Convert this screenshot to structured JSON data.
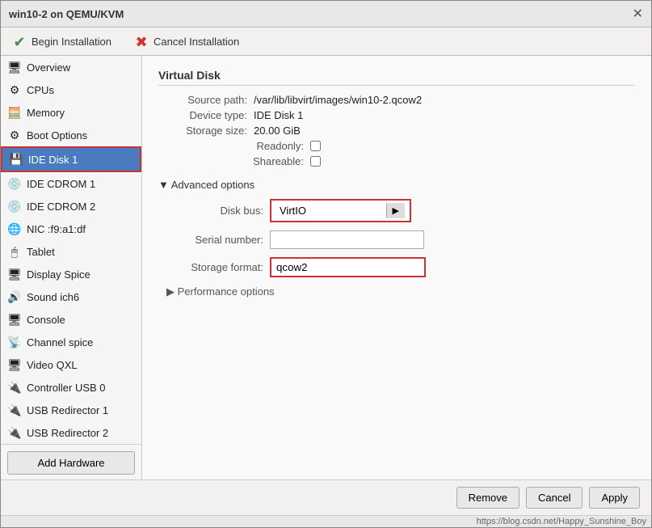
{
  "window": {
    "title": "win10-2 on QEMU/KVM",
    "close_label": "✕"
  },
  "toolbar": {
    "begin_label": "Begin Installation",
    "cancel_label": "Cancel Installation"
  },
  "sidebar": {
    "items": [
      {
        "id": "overview",
        "label": "Overview",
        "icon": "🖥"
      },
      {
        "id": "cpus",
        "label": "CPUs",
        "icon": "⚙"
      },
      {
        "id": "memory",
        "label": "Memory",
        "icon": "🧮"
      },
      {
        "id": "boot-options",
        "label": "Boot Options",
        "icon": "⚙"
      },
      {
        "id": "ide-disk-1",
        "label": "IDE Disk 1",
        "icon": "💾",
        "active": true
      },
      {
        "id": "ide-cdrom-1",
        "label": "IDE CDROM 1",
        "icon": "💿"
      },
      {
        "id": "ide-cdrom-2",
        "label": "IDE CDROM 2",
        "icon": "💿"
      },
      {
        "id": "nic",
        "label": "NIC :f9:a1:df",
        "icon": "🌐"
      },
      {
        "id": "tablet",
        "label": "Tablet",
        "icon": "🖱"
      },
      {
        "id": "display-spice",
        "label": "Display Spice",
        "icon": "🖥"
      },
      {
        "id": "sound-ich6",
        "label": "Sound ich6",
        "icon": "🔊"
      },
      {
        "id": "console",
        "label": "Console",
        "icon": "🖥"
      },
      {
        "id": "channel-spice",
        "label": "Channel spice",
        "icon": "📡"
      },
      {
        "id": "video-qxl",
        "label": "Video QXL",
        "icon": "🖥"
      },
      {
        "id": "controller-usb-0",
        "label": "Controller USB 0",
        "icon": "🔌"
      },
      {
        "id": "usb-redirector-1",
        "label": "USB Redirector 1",
        "icon": "🔌"
      },
      {
        "id": "usb-redirector-2",
        "label": "USB Redirector 2",
        "icon": "🔌"
      }
    ],
    "add_hardware_label": "Add Hardware"
  },
  "main": {
    "section_title": "Virtual Disk",
    "source_path_label": "Source path:",
    "source_path_value": "/var/lib/libvirt/images/win10-2.qcow2",
    "device_type_label": "Device type:",
    "device_type_value": "IDE Disk 1",
    "storage_size_label": "Storage size:",
    "storage_size_value": "20.00 GiB",
    "readonly_label": "Readonly:",
    "shareable_label": "Shareable:",
    "advanced_title": "▼ Advanced options",
    "diskbus_label": "Disk bus:",
    "diskbus_value": "VirtIO",
    "diskbus_arrow": "▶",
    "serial_label": "Serial number:",
    "serial_value": "",
    "storage_format_label": "Storage format:",
    "storage_format_value": "qcow2",
    "performance_label": "▶ Performance options"
  },
  "footer": {
    "remove_label": "Remove",
    "cancel_label": "Cancel",
    "apply_label": "Apply"
  },
  "url": "https://blog.csdn.net/Happy_Sunshine_Boy"
}
